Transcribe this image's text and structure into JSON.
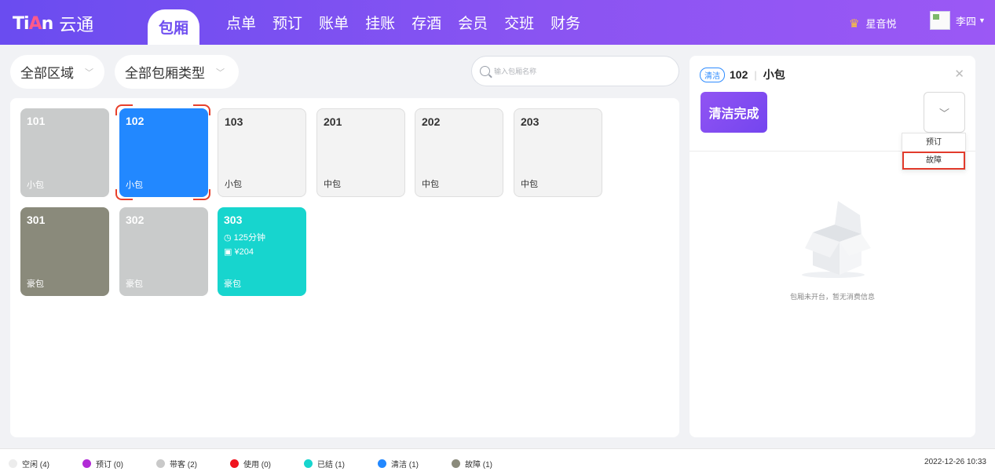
{
  "header": {
    "logo_mark": "TiAn",
    "logo_text": "云通",
    "nav": [
      "包厢",
      "点单",
      "预订",
      "账单",
      "挂账",
      "存酒",
      "会员",
      "交班",
      "财务"
    ],
    "brand": "星音悦",
    "user": "李四"
  },
  "filters": {
    "area": "全部区域",
    "room_type": "全部包厢类型",
    "search_placeholder": "输入包厢名称"
  },
  "rooms": [
    {
      "num": "101",
      "type": "小包",
      "status": "hold"
    },
    {
      "num": "102",
      "type": "小包",
      "status": "clean",
      "selected": true
    },
    {
      "num": "103",
      "type": "小包",
      "status": "idle"
    },
    {
      "num": "201",
      "type": "中包",
      "status": "idle"
    },
    {
      "num": "202",
      "type": "中包",
      "status": "idle"
    },
    {
      "num": "203",
      "type": "中包",
      "status": "idle"
    },
    {
      "num": "301",
      "type": "豪包",
      "status": "fault"
    },
    {
      "num": "302",
      "type": "豪包",
      "status": "hold"
    },
    {
      "num": "303",
      "type": "豪包",
      "status": "done",
      "duration": "125分钟",
      "amount": "¥204"
    }
  ],
  "side": {
    "status_badge": "清洁",
    "room_num": "102",
    "room_type": "小包",
    "primary_action": "清洁完成",
    "menu": [
      "预订",
      "故障"
    ],
    "empty_text": "包厢未开台，暂无消费信息"
  },
  "legend": [
    {
      "label": "空闲 (4)",
      "color": "#ececec"
    },
    {
      "label": "预订 (0)",
      "color": "#b12bd6"
    },
    {
      "label": "带客 (2)",
      "color": "#c9c9c9"
    },
    {
      "label": "使用 (0)",
      "color": "#f0141e"
    },
    {
      "label": "已结 (1)",
      "color": "#17d5ce"
    },
    {
      "label": "清洁 (1)",
      "color": "#2288ff"
    },
    {
      "label": "故障 (1)",
      "color": "#8a8a7b"
    }
  ],
  "datetime": "2022-12-26 10:33"
}
